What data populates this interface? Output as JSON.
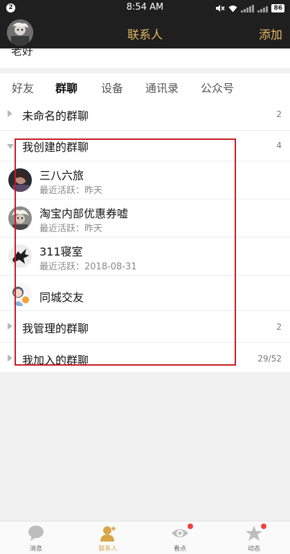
{
  "status_bar": {
    "badge": "2",
    "time": "8:54 AM",
    "battery": "86"
  },
  "header": {
    "title": "联系人",
    "add_label": "添加"
  },
  "partial_row": {
    "text": "老好"
  },
  "tabs": [
    {
      "label": "好友"
    },
    {
      "label": "群聊"
    },
    {
      "label": "设备"
    },
    {
      "label": "通讯录"
    },
    {
      "label": "公众号"
    }
  ],
  "active_tab": "群聊",
  "groups": {
    "unnamed": {
      "label": "未命名的群聊",
      "count": "2"
    },
    "created": {
      "label": "我创建的群聊",
      "count": "4"
    },
    "managed": {
      "label": "我管理的群聊",
      "count": "2"
    },
    "joined": {
      "label": "我加入的群聊",
      "count": "29/52"
    }
  },
  "created_chats": [
    {
      "name": "三八六旅",
      "active": "最近活跃：昨天"
    },
    {
      "name": "淘宝内部优惠券嘘",
      "active": "最近活跃：昨天"
    },
    {
      "name": "311寝室",
      "active": "最近活跃：2018-08-31"
    },
    {
      "name": "同城交友",
      "active": ""
    }
  ],
  "bottom_nav": [
    {
      "label": "消息",
      "icon": "chat-bubble-icon"
    },
    {
      "label": "联系人",
      "icon": "contact-person-icon"
    },
    {
      "label": "看点",
      "icon": "eye-icon"
    },
    {
      "label": "动态",
      "icon": "star-icon"
    }
  ],
  "colors": {
    "header_bg": "#1f1f1f",
    "accent_gold": "#e3b765",
    "highlight_red": "#c61a20",
    "notify_red": "#f0433d"
  }
}
